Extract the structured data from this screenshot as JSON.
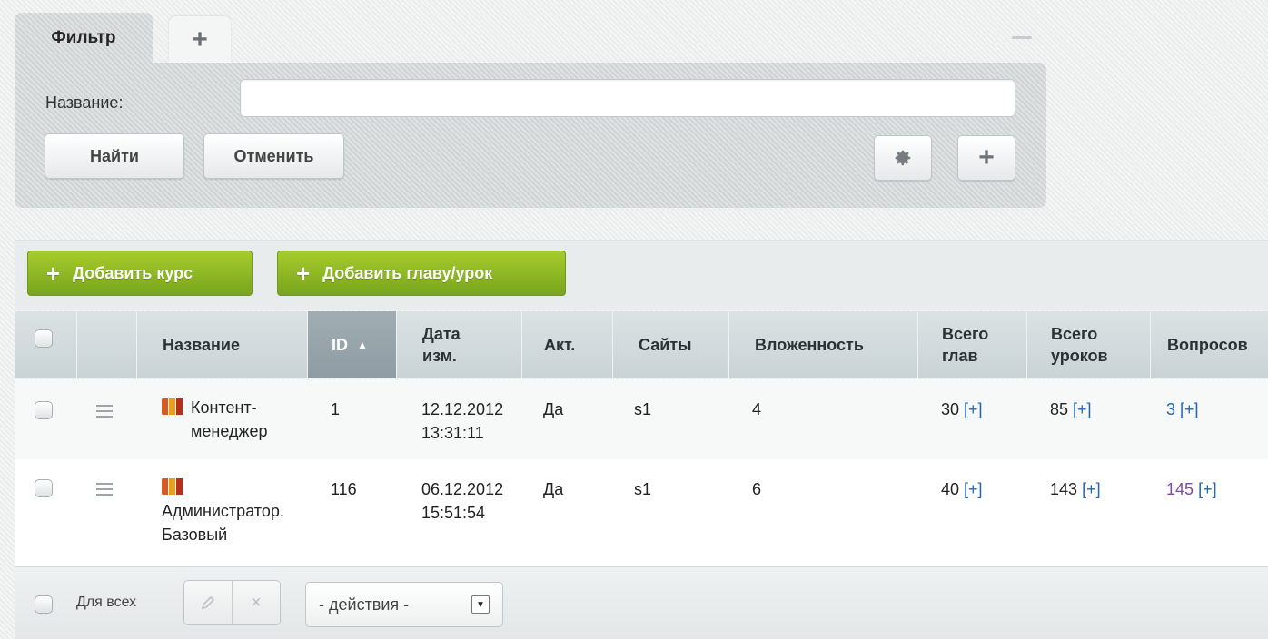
{
  "filter": {
    "tab_label": "Фильтр",
    "add_tab_label": "+",
    "name_label": "Название:",
    "name_value": "",
    "find_label": "Найти",
    "cancel_label": "Отменить",
    "settings_icon": "gear-icon",
    "add_icon": "+"
  },
  "toolbar": {
    "add_course_label": "Добавить курс",
    "add_chapter_label": "Добавить главу/урок",
    "plus": "+"
  },
  "table": {
    "columns": {
      "name": "Название",
      "id": "ID",
      "date_line1": "Дата",
      "date_line2": "изм.",
      "active": "Акт.",
      "sites": "Сайты",
      "depth": "Вложенность",
      "chapters_line1": "Всего",
      "chapters_line2": "глав",
      "lessons_line1": "Всего",
      "lessons_line2": "уроков",
      "questions": "Вопросов"
    },
    "sort": {
      "column": "ID",
      "direction": "ascending",
      "indicator": "▲"
    },
    "rows": [
      {
        "name_line1": "Контент-",
        "name_line2": "менеджер",
        "id": "1",
        "date_line1": "12.12.2012",
        "date_line2": "13:31:11",
        "active": "Да",
        "sites": "s1",
        "depth": "4",
        "chapters": "30",
        "lessons": "85",
        "questions": "3",
        "add_link": "[+]"
      },
      {
        "name_line1": "Администратор.",
        "name_line2": "Базовый",
        "id": "116",
        "date_line1": "06.12.2012",
        "date_line2": "15:51:54",
        "active": "Да",
        "sites": "s1",
        "depth": "6",
        "chapters": "40",
        "lessons": "143",
        "questions": "145",
        "add_link": "[+]"
      }
    ]
  },
  "footer": {
    "for_all_label": "Для всех",
    "actions_select": "- действия -",
    "edit_icon": "pencil-icon",
    "delete_icon": "×"
  },
  "colors": {
    "green_button": "#8ab826",
    "header_bg": "#d1dadc",
    "sorted_header": "#96a4ab",
    "link": "#2067b0",
    "visited_link": "#7e4aa8"
  }
}
